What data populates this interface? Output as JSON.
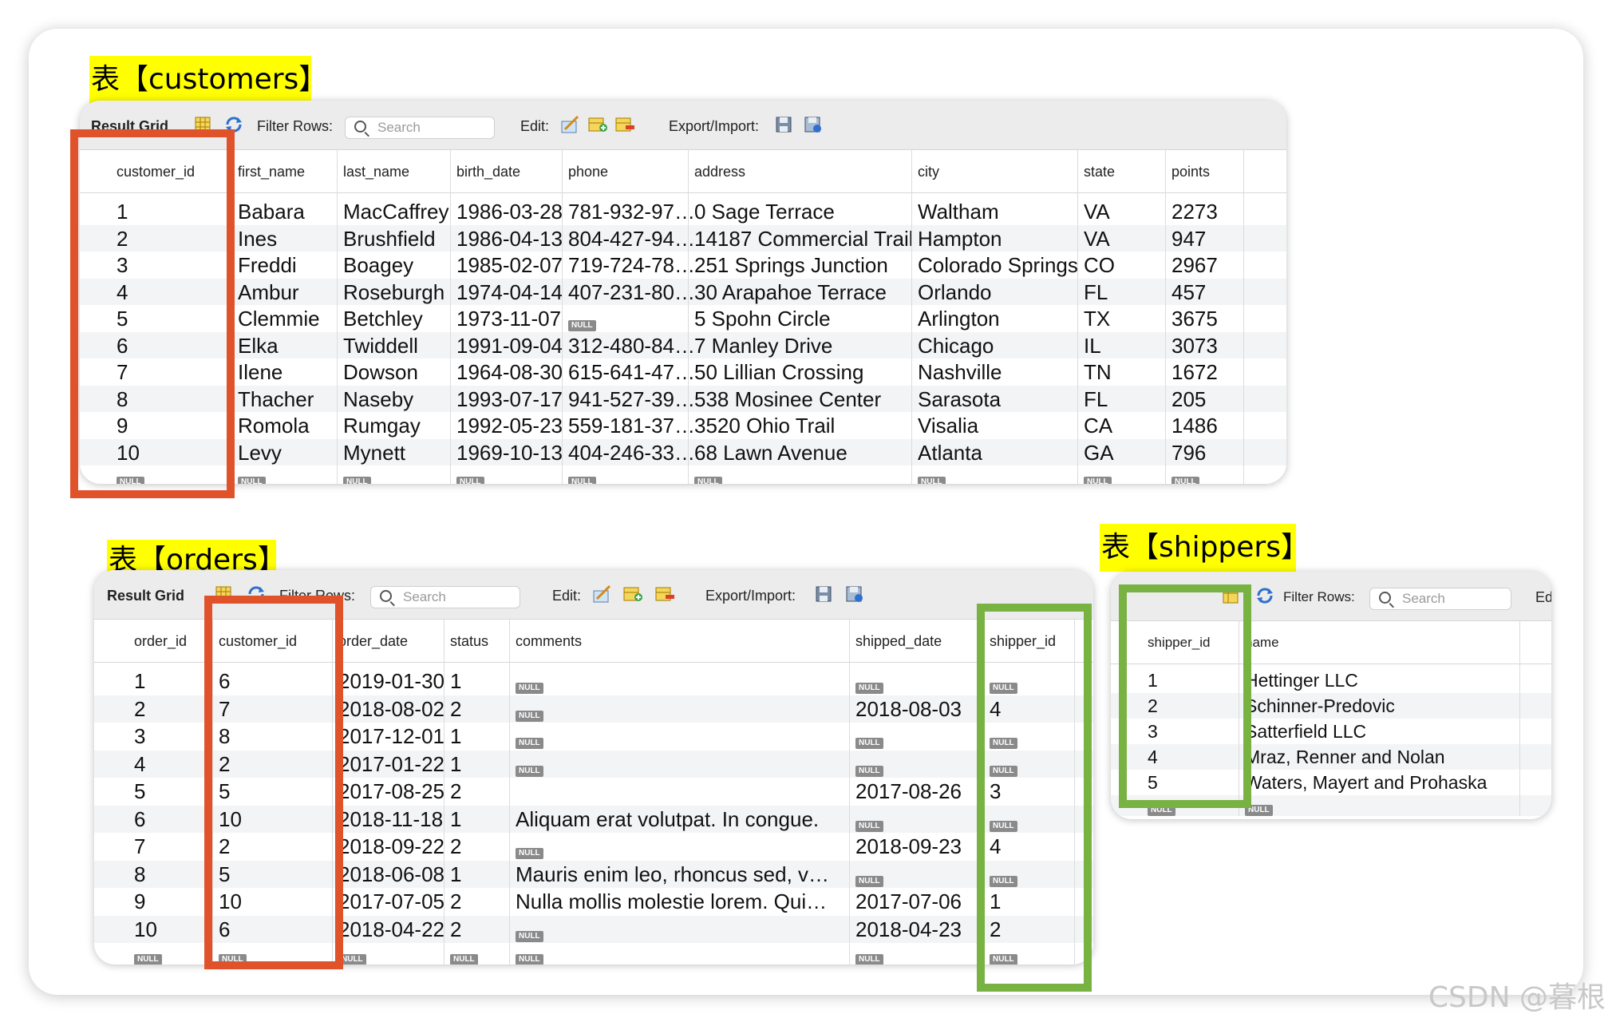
{
  "customers": {
    "title": "表【customers】",
    "toolbar": {
      "result_grid": "Result Grid",
      "filter_rows": "Filter Rows:",
      "search_placeholder": "Search",
      "edit": "Edit:",
      "export_import": "Export/Import:"
    },
    "columns": [
      "customer_id",
      "first_name",
      "last_name",
      "birth_date",
      "phone",
      "address",
      "city",
      "state",
      "points"
    ],
    "rows": [
      [
        "1",
        "Babara",
        "MacCaffrey",
        "1986-03-28",
        "781-932-97…",
        "0 Sage Terrace",
        "Waltham",
        "VA",
        "2273"
      ],
      [
        "2",
        "Ines",
        "Brushfield",
        "1986-04-13",
        "804-427-94…",
        "14187 Commercial Trail",
        "Hampton",
        "VA",
        "947"
      ],
      [
        "3",
        "Freddi",
        "Boagey",
        "1985-02-07",
        "719-724-78…",
        "251 Springs Junction",
        "Colorado Springs",
        "CO",
        "2967"
      ],
      [
        "4",
        "Ambur",
        "Roseburgh",
        "1974-04-14",
        "407-231-80…",
        "30 Arapahoe Terrace",
        "Orlando",
        "FL",
        "457"
      ],
      [
        "5",
        "Clemmie",
        "Betchley",
        "1973-11-07",
        "NULL",
        "5 Spohn Circle",
        "Arlington",
        "TX",
        "3675"
      ],
      [
        "6",
        "Elka",
        "Twiddell",
        "1991-09-04",
        "312-480-84…",
        "7 Manley Drive",
        "Chicago",
        "IL",
        "3073"
      ],
      [
        "7",
        "Ilene",
        "Dowson",
        "1964-08-30",
        "615-641-47…",
        "50 Lillian Crossing",
        "Nashville",
        "TN",
        "1672"
      ],
      [
        "8",
        "Thacher",
        "Naseby",
        "1993-07-17",
        "941-527-39…",
        "538 Mosinee Center",
        "Sarasota",
        "FL",
        "205"
      ],
      [
        "9",
        "Romola",
        "Rumgay",
        "1992-05-23",
        "559-181-37…",
        "3520 Ohio Trail",
        "Visalia",
        "CA",
        "1486"
      ],
      [
        "10",
        "Levy",
        "Mynett",
        "1969-10-13",
        "404-246-33…",
        "68 Lawn Avenue",
        "Atlanta",
        "GA",
        "796"
      ],
      [
        "NULL",
        "NULL",
        "NULL",
        "NULL",
        "NULL",
        "NULL",
        "NULL",
        "NULL",
        "NULL"
      ]
    ]
  },
  "orders": {
    "title": "表【orders】",
    "toolbar": {
      "result_grid": "Result Grid",
      "filter_rows": "Filter Rows:",
      "search_placeholder": "Search",
      "edit": "Edit:",
      "export_import": "Export/Import:"
    },
    "columns": [
      "order_id",
      "customer_id",
      "order_date",
      "status",
      "comments",
      "shipped_date",
      "shipper_id"
    ],
    "rows": [
      [
        "1",
        "6",
        "2019-01-30",
        "1",
        "NULL",
        "NULL",
        "NULL"
      ],
      [
        "2",
        "7",
        "2018-08-02",
        "2",
        "NULL",
        "2018-08-03",
        "4"
      ],
      [
        "3",
        "8",
        "2017-12-01",
        "1",
        "NULL",
        "NULL",
        "NULL"
      ],
      [
        "4",
        "2",
        "2017-01-22",
        "1",
        "NULL",
        "NULL",
        "NULL"
      ],
      [
        "5",
        "5",
        "2017-08-25",
        "2",
        "",
        "2017-08-26",
        "3"
      ],
      [
        "6",
        "10",
        "2018-11-18",
        "1",
        "Aliquam erat volutpat. In congue.",
        "NULL",
        "NULL"
      ],
      [
        "7",
        "2",
        "2018-09-22",
        "2",
        "NULL",
        "2018-09-23",
        "4"
      ],
      [
        "8",
        "5",
        "2018-06-08",
        "1",
        "Mauris enim leo, rhoncus sed, v…",
        "NULL",
        "NULL"
      ],
      [
        "9",
        "10",
        "2017-07-05",
        "2",
        "Nulla mollis molestie lorem. Qui…",
        "2017-07-06",
        "1"
      ],
      [
        "10",
        "6",
        "2018-04-22",
        "2",
        "NULL",
        "2018-04-23",
        "2"
      ],
      [
        "NULL",
        "NULL",
        "NULL",
        "NULL",
        "NULL",
        "NULL",
        "NULL"
      ]
    ]
  },
  "shippers": {
    "title": "表【shippers】",
    "toolbar": {
      "filter_rows": "Filter Rows:",
      "search_placeholder": "Search",
      "edit_truncated": "Ed"
    },
    "columns": [
      "shipper_id",
      "name"
    ],
    "rows": [
      [
        "1",
        "Hettinger LLC"
      ],
      [
        "2",
        "Schinner-Predovic"
      ],
      [
        "3",
        "Satterfield LLC"
      ],
      [
        "4",
        "Mraz, Renner and Nolan"
      ],
      [
        "5",
        "Waters, Mayert and Prohaska"
      ],
      [
        "NULL",
        "NULL"
      ]
    ]
  },
  "watermark": "CSDN @暮根",
  "colors": {
    "title_highlight": "#ffff00",
    "primary_key_box": "#e0522a",
    "foreign_key_box": "#77b243",
    "row_alt": "#f3f4f6"
  },
  "icons": [
    "grid-icon",
    "refresh-icon",
    "search-icon",
    "edit-row-icon",
    "add-row-icon",
    "delete-row-icon",
    "export-icon",
    "import-icon"
  ]
}
